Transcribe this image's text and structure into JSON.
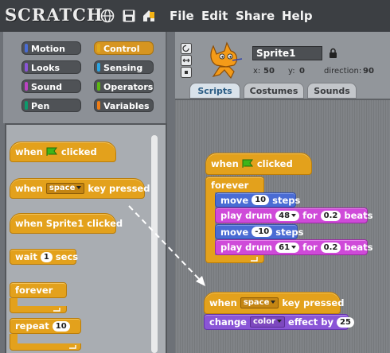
{
  "app": {
    "logo": "SCRATCH"
  },
  "menu": {
    "file": "File",
    "edit": "Edit",
    "share": "Share",
    "help": "Help"
  },
  "categories": [
    {
      "label": "Motion",
      "color": "#4a6cd4"
    },
    {
      "label": "Control",
      "color": "#e1a91a",
      "active": true
    },
    {
      "label": "Looks",
      "color": "#8a55d7"
    },
    {
      "label": "Sensing",
      "color": "#2ca5e2"
    },
    {
      "label": "Sound",
      "color": "#bb42c3"
    },
    {
      "label": "Operators",
      "color": "#5cb712"
    },
    {
      "label": "Pen",
      "color": "#0e9a6c"
    },
    {
      "label": "Variables",
      "color": "#ee7d16"
    }
  ],
  "palette": {
    "when_flag": {
      "prefix": "when",
      "suffix": "clicked"
    },
    "when_key": {
      "prefix": "when",
      "key": "space",
      "suffix": "key pressed"
    },
    "when_sprite": {
      "text": "when Sprite1 clicked"
    },
    "wait": {
      "prefix": "wait",
      "value": "1",
      "suffix": "secs"
    },
    "forever": {
      "text": "forever"
    },
    "repeat": {
      "prefix": "repeat",
      "value": "10"
    }
  },
  "sprite": {
    "name": "Sprite1",
    "x_label": "x:",
    "x": "50",
    "y_label": "y:",
    "y": "0",
    "direction_label": "direction:",
    "direction": "90"
  },
  "tabs": {
    "scripts": "Scripts",
    "costumes": "Costumes",
    "sounds": "Sounds"
  },
  "script1": {
    "hat": {
      "prefix": "when",
      "suffix": "clicked"
    },
    "forever": "forever",
    "move1": {
      "prefix": "move",
      "value": "10",
      "suffix": "steps"
    },
    "drum1": {
      "prefix": "play drum",
      "drum": "48",
      "for": "for",
      "beats": "0.2",
      "suffix": "beats"
    },
    "move2": {
      "prefix": "move",
      "value": "-10",
      "suffix": "steps"
    },
    "drum2": {
      "prefix": "play drum",
      "drum": "61",
      "for": "for",
      "beats": "0.2",
      "suffix": "beats"
    }
  },
  "script2": {
    "hat": {
      "prefix": "when",
      "key": "space",
      "suffix": "key pressed"
    },
    "effect": {
      "prefix": "change",
      "effect": "color",
      "mid": "effect by",
      "value": "25"
    }
  }
}
